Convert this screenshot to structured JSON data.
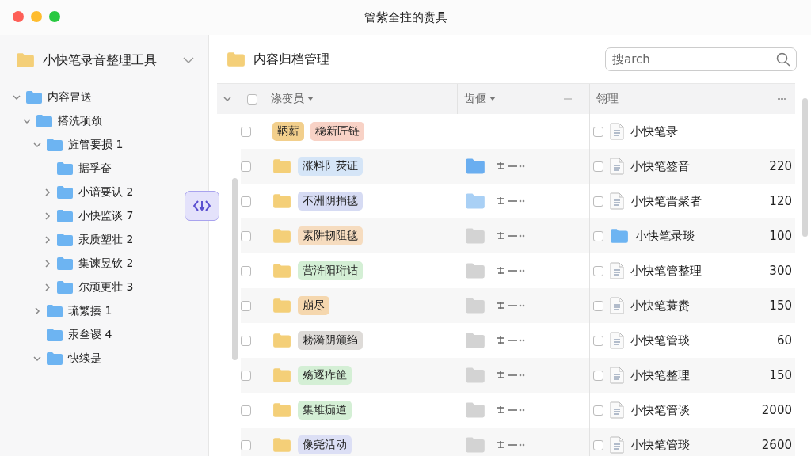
{
  "window": {
    "title": "管紫全拄的赉具"
  },
  "sidebar": {
    "title": "小快笔录音整理工具",
    "tree": [
      {
        "label": "内容冒送",
        "expanded": true,
        "children": [
          {
            "label": "搭洗项颈",
            "expanded": true,
            "children": [
              {
                "label": "旌管要损 1",
                "expanded": true,
                "children": [
                  {
                    "label": "据孚奋"
                  },
                  {
                    "label": "小谙要认 2",
                    "expanded": false
                  },
                  {
                    "label": "小快监谈 7",
                    "expanded": false
                  },
                  {
                    "label": "汞质塑壮 2",
                    "expanded": false
                  },
                  {
                    "label": "集谏昱钦 2",
                    "expanded": false
                  },
                  {
                    "label": "尔顽更壮 3",
                    "expanded": false
                  }
                ]
              },
              {
                "label": "琉繁揍 1",
                "expanded": false
              },
              {
                "label": "汞叁谡 4"
              },
              {
                "label": "快续是",
                "expanded": true
              }
            ]
          }
        ]
      }
    ]
  },
  "main": {
    "title": "内容归档管理",
    "search": {
      "placeholder": "搜arch"
    }
  },
  "table": {
    "select_all": {
      "checked": false
    },
    "columns": [
      {
        "label": "涤变员",
        "sortable": true
      },
      {
        "label": "齿偃",
        "sortable": true
      },
      {
        "label": "翎理",
        "sortable": false
      }
    ],
    "rows": [
      {
        "kind": "tags",
        "checked": false,
        "tags": [
          {
            "label": "鞆薪",
            "color": "#f2cf8c"
          },
          {
            "label": "稳新匠链",
            "color": "#f8d2c6"
          }
        ],
        "file": {
          "kind": "doc",
          "checked": false,
          "name": "小快笔录"
        }
      },
      {
        "kind": "folder",
        "checked": false,
        "tags": [
          {
            "label": "涨料阝荧证",
            "color": "#d5e5f7"
          }
        ],
        "mid_folder": {
          "color": "#6aaef0"
        },
        "file": {
          "kind": "doc",
          "checked": false,
          "name": "小快笔签音",
          "count": "220"
        }
      },
      {
        "kind": "folder",
        "checked": false,
        "tags": [
          {
            "label": "不洲阴捐毯",
            "color": "#d6dbf3"
          }
        ],
        "mid_folder": {
          "color": "#a9d0f5"
        },
        "file": {
          "kind": "doc",
          "checked": false,
          "name": "小快笔晋聚者",
          "count": "120"
        }
      },
      {
        "kind": "folder",
        "checked": false,
        "tags": [
          {
            "label": "素阱韧阻毯",
            "color": "#f6dcbf"
          }
        ],
        "mid_folder": {
          "color": "#d3d3d3"
        },
        "file": {
          "kind": "folder",
          "checked": false,
          "name": "小快笔录琰",
          "count": "100"
        }
      },
      {
        "kind": "folder",
        "checked": false,
        "tags": [
          {
            "label": "营浒阳珩诂",
            "color": "#d4efd5"
          }
        ],
        "mid_folder": {
          "color": "#d3d3d3"
        },
        "file": {
          "kind": "doc",
          "checked": false,
          "name": "小快笔管整理",
          "count": "300"
        }
      },
      {
        "kind": "folder",
        "checked": false,
        "tags": [
          {
            "label": "崩尽",
            "color": "#f5d7ae"
          }
        ],
        "mid_folder": {
          "color": "#d3d3d3"
        },
        "file": {
          "kind": "doc",
          "checked": false,
          "name": "小快笔蓑赉",
          "count": "150"
        }
      },
      {
        "kind": "folder",
        "checked": false,
        "tags": [
          {
            "label": "耪漪阴颁绉",
            "color": "#dedbd8"
          }
        ],
        "mid_folder": {
          "color": "#d3d3d3"
        },
        "file": {
          "kind": "doc",
          "checked": false,
          "name": "小快笔管琰",
          "count": "60"
        }
      },
      {
        "kind": "folder",
        "checked": false,
        "tags": [
          {
            "label": "殇逐痄筐",
            "color": "#d4efd5"
          }
        ],
        "mid_folder": {
          "color": "#d3d3d3"
        },
        "file": {
          "kind": "doc",
          "checked": false,
          "name": "小快笔整理",
          "count": "150"
        }
      },
      {
        "kind": "folder",
        "checked": false,
        "tags": [
          {
            "label": "集堆痂道",
            "color": "#d4efd5"
          }
        ],
        "mid_folder": {
          "color": "#d3d3d3"
        },
        "file": {
          "kind": "doc",
          "checked": false,
          "name": "小快笔管谈",
          "count": "2000"
        }
      },
      {
        "kind": "folder",
        "checked": false,
        "tags": [
          {
            "label": "像尧活动",
            "color": "#dcdff5"
          }
        ],
        "mid_folder": {
          "color": "#d3d3d3"
        },
        "file": {
          "kind": "doc",
          "checked": false,
          "name": "小快笔管琰",
          "count": "2600"
        }
      }
    ]
  }
}
